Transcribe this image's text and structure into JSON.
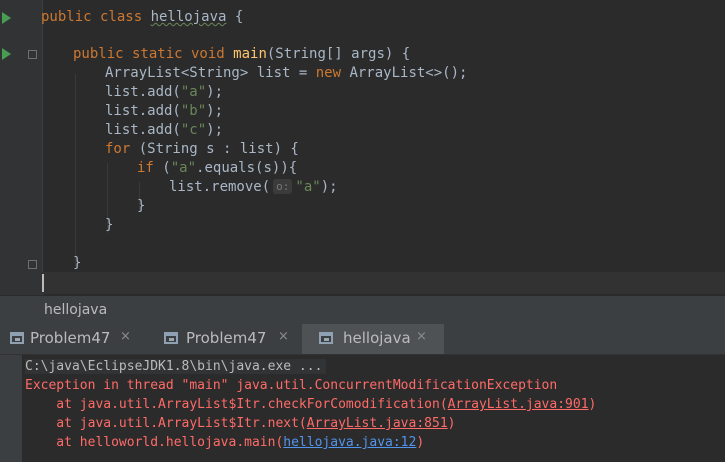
{
  "editor": {
    "lines": {
      "l1": {
        "kw": "public class ",
        "name": "hellojava",
        "rest": " {"
      },
      "l2": {
        "kw": "public static void ",
        "fn": "main",
        "rest": "(String[] args) {"
      },
      "l3": {
        "a": "ArrayList<String> list = ",
        "kw": "new ",
        "b": "ArrayList<>();"
      },
      "l4": {
        "a": "list.add(",
        "str": "\"a\"",
        "b": ");"
      },
      "l5": {
        "a": "list.add(",
        "str": "\"b\"",
        "b": ");"
      },
      "l6": {
        "a": "list.add(",
        "str": "\"c\"",
        "b": ");"
      },
      "l7": {
        "kw": "for ",
        "rest": "(String s : list) {"
      },
      "l8": {
        "kw": "if ",
        "a": "(",
        "str": "\"a\"",
        "b": ".equals(s)){"
      },
      "l9": {
        "a": "list.remove(",
        "hint": "o:",
        "str": "\"a\"",
        "b": ");"
      },
      "l10": {
        "text": "}"
      },
      "l11": {
        "text": "}"
      },
      "l12": {
        "text": "}"
      }
    }
  },
  "run_panel": {
    "title": "hellojava",
    "tabs": [
      {
        "label": "Problem47",
        "close": "×",
        "active": false
      },
      {
        "label": "Problem47",
        "close": "×",
        "active": false
      },
      {
        "label": "hellojava",
        "close": "×",
        "active": true
      }
    ]
  },
  "console": {
    "command": "C:\\java\\EclipseJDK1.8\\bin\\java.exe ...",
    "exception": "Exception in thread \"main\" java.util.ConcurrentModificationException",
    "trace": [
      {
        "prefix": "    at java.util.ArrayList$Itr.checkForComodification(",
        "link": "ArrayList.java:901",
        "suffix": ")"
      },
      {
        "prefix": "    at java.util.ArrayList$Itr.next(",
        "link": "ArrayList.java:851",
        "suffix": ")"
      },
      {
        "prefix": "    at helloworld.hellojava.main(",
        "link": "hellojava.java:12",
        "suffix": ")"
      }
    ]
  },
  "colors": {
    "editor_bg": "#2b2b2b",
    "keyword": "#cc7832",
    "string": "#6a8759",
    "method": "#ffc66d",
    "error": "#ff6b68",
    "link": "#5394ec",
    "run_arrow": "#499c54"
  },
  "icons": [
    "run-arrow-icon",
    "fold-icon",
    "window-tab-icon",
    "close-icon"
  ]
}
